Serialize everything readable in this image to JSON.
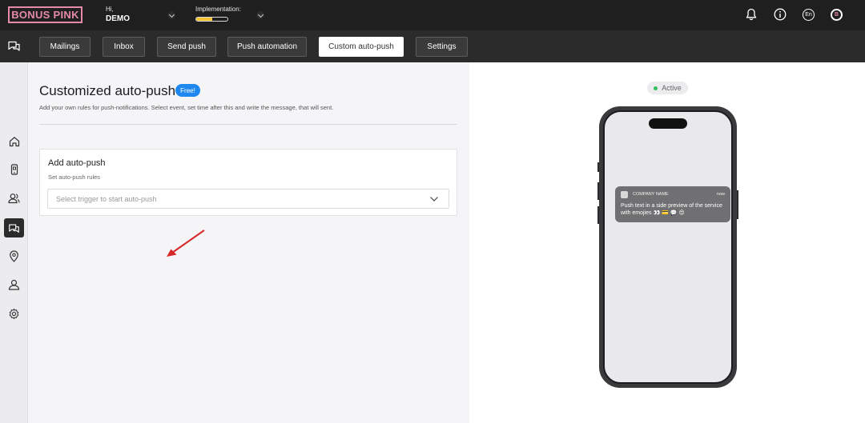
{
  "brand": {
    "logo_text": "BONUS PINK",
    "accent": "#e58aa8"
  },
  "user": {
    "greeting": "Hi,",
    "name": "DEMO"
  },
  "implementation": {
    "label": "Implementation:",
    "progress": 0.5
  },
  "top_icons": [
    "bell-icon",
    "info-icon",
    "language-icon",
    "user-avatar"
  ],
  "language": "En",
  "avatar_letter": "B",
  "tabs": [
    {
      "label": "Mailings",
      "active": false
    },
    {
      "label": "Inbox",
      "active": false
    },
    {
      "label": "Send push",
      "active": false
    },
    {
      "label": "Push automation",
      "active": false
    },
    {
      "label": "Custom auto-push",
      "active": true
    },
    {
      "label": "Settings",
      "active": false
    }
  ],
  "sidebar": [
    "home-icon",
    "mobile-icon",
    "users-icon",
    "chat-icon",
    "location-icon",
    "user-icon",
    "settings-icon"
  ],
  "main": {
    "title": "Customized auto-push",
    "badge": "Free!",
    "description": "Add your own rules for push-notifications. Select event, set time after this and write the message, that will sent.",
    "card": {
      "title": "Add auto-push",
      "subtitle": "Set auto-push rules",
      "select_placeholder": "Select trigger to start auto-push"
    }
  },
  "preview": {
    "status": "Active",
    "notification": {
      "app_name": "COMPANY NAME",
      "time": "now",
      "text": "Push text in a side preview of the service with emojies 👀 💳 💬 😍"
    }
  }
}
